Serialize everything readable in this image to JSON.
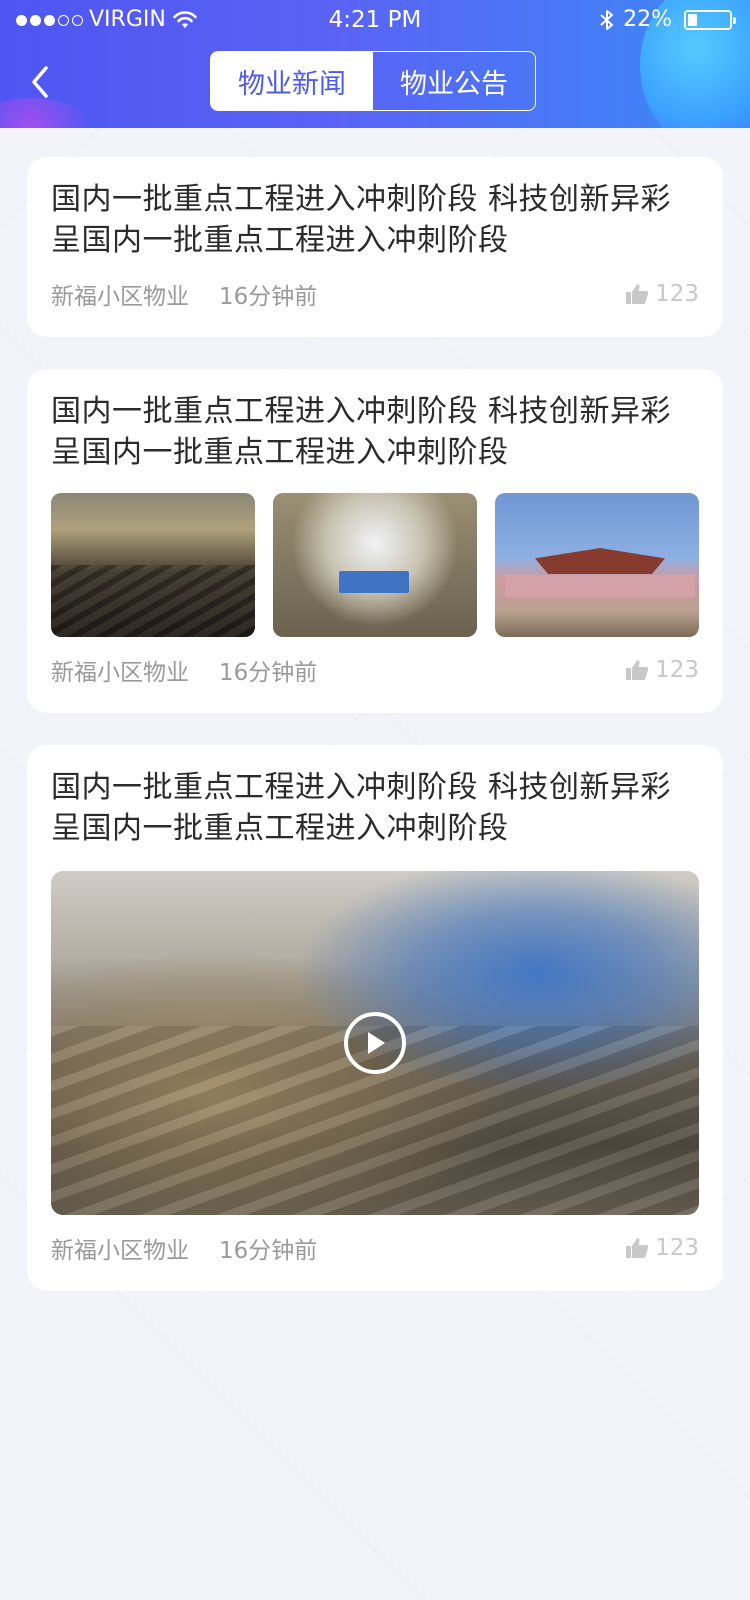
{
  "status_bar": {
    "carrier": "VIRGIN",
    "time": "4:21 PM",
    "battery": "22%",
    "battery_level": 0.22
  },
  "header": {
    "back_icon": "chevron-left-icon",
    "tabs": [
      {
        "label": "物业新闻",
        "active": true
      },
      {
        "label": "物业公告",
        "active": false
      }
    ]
  },
  "feed": [
    {
      "type": "text",
      "title": "国内一批重点工程进入冲刺阶段 科技创新异彩呈国内一批重点工程进入冲刺阶段",
      "source": "新福小区物业",
      "time": "16分钟前",
      "likes": "123"
    },
    {
      "type": "images",
      "title": "国内一批重点工程进入冲刺阶段 科技创新异彩呈国内一批重点工程进入冲刺阶段",
      "source": "新福小区物业",
      "time": "16分钟前",
      "likes": "123"
    },
    {
      "type": "video",
      "title": "国内一批重点工程进入冲刺阶段 科技创新异彩呈国内一批重点工程进入冲刺阶段",
      "source": "新福小区物业",
      "time": "16分钟前",
      "likes": "123"
    }
  ],
  "colors": {
    "accent": "#4d5af2",
    "header_gradient_start": "#4f55f2",
    "header_gradient_end": "#3b8bf8",
    "background": "#f3f4fa",
    "title_text": "#2b2b2b",
    "meta_text": "#9a9a9a",
    "like_icon": "#c8c8c8"
  }
}
